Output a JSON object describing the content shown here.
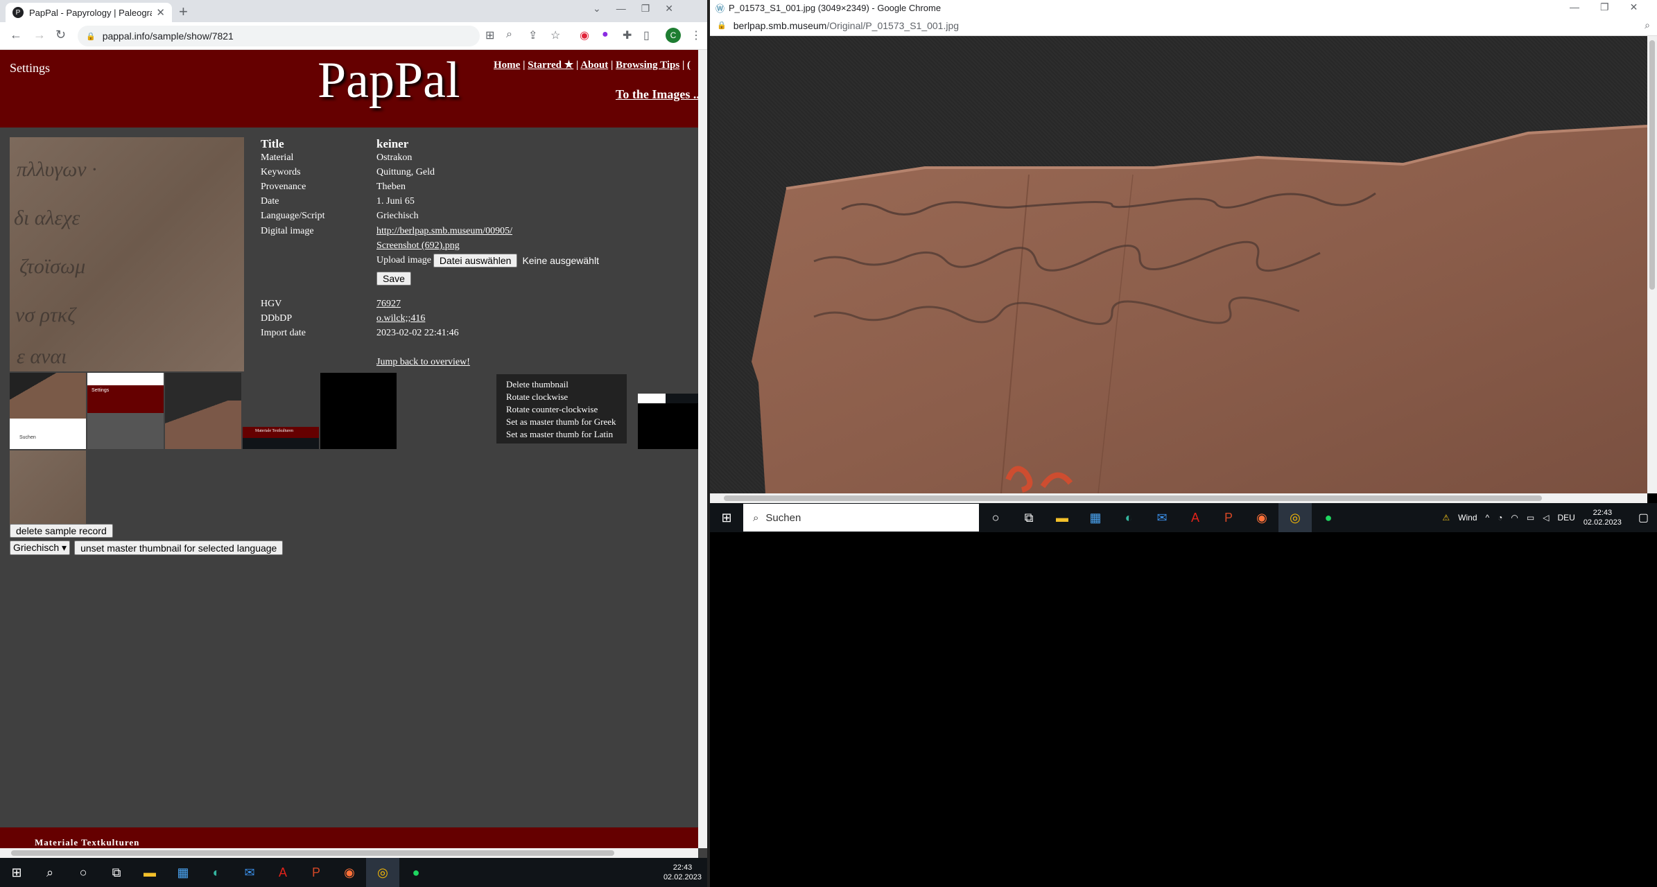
{
  "left_browser": {
    "tab_title": "PapPal - Papyrology | Paleograph",
    "tab_favicon": "P",
    "url": "pappal.info/sample/show/7821",
    "profile_initial": "C"
  },
  "site": {
    "settings": "Settings",
    "logo": "PapPal",
    "nav": [
      "Home",
      "Starred ★",
      "About",
      "Browsing Tips",
      "("
    ],
    "to_images": "To the Images ..."
  },
  "record": {
    "title_label": "Title",
    "title_value": "keiner",
    "fields": [
      {
        "label": "Material",
        "value": "Ostrakon"
      },
      {
        "label": "Keywords",
        "value": "Quittung, Geld"
      },
      {
        "label": "Provenance",
        "value": "Theben"
      },
      {
        "label": "Date",
        "value": "1. Juni 65"
      },
      {
        "label": "Language/Script",
        "value": "Griechisch"
      }
    ],
    "digital_image_label": "Digital image",
    "digital_image_link": "http://berlpap.smb.museum/00905/",
    "screenshot_link": "Screenshot (692).png",
    "upload_label": "Upload image",
    "file_button": "Datei auswählen",
    "file_status": "Keine ausgewählt",
    "save_button": "Save",
    "hgv_label": "HGV",
    "hgv_value": "76927",
    "ddbdp_label": "DDbDP",
    "ddbdp_value": "o.wilck;;416",
    "import_label": "Import date",
    "import_value": "2023-02-02 22:41:46",
    "jump_back": "Jump back to overview!"
  },
  "context_menu": [
    "Delete thumbnail",
    "Rotate clockwise",
    "Rotate counter-clockwise",
    "Set as master thumb for Greek",
    "Set as master thumb for Latin"
  ],
  "thumb_mini_texts": {
    "settings": "Settings",
    "search": "Suchen",
    "banner": "Materiale Textkulturen"
  },
  "actions": {
    "delete_record": "delete sample record",
    "language_select": "Griechisch",
    "unset_master": "unset master thumbnail for selected language"
  },
  "footer_text": "Materiale Textkulturen",
  "right_browser": {
    "title": "P_01573_S1_001.jpg (3049×2349) - Google Chrome",
    "url_host": "berlpap.smb.museum",
    "url_path": "/Original/P_01573_S1_001.jpg"
  },
  "right_taskbar": {
    "search": "Suchen",
    "weather": "Wind",
    "lang": "DEU",
    "time": "22:43",
    "date": "02.02.2023"
  },
  "left_taskbar": {
    "time": "22:43",
    "date": "02.02.2023"
  }
}
